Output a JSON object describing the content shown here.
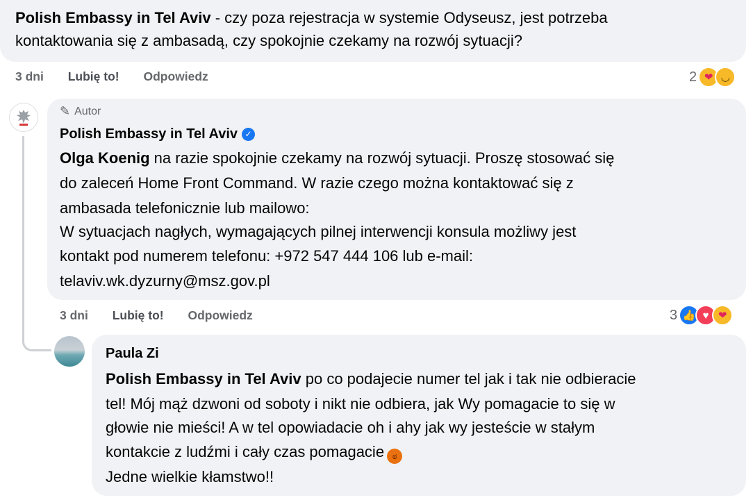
{
  "comment1": {
    "author": "Polish Embassy in Tel Aviv",
    "line1_rest": " - czy poza rejestracja w systemie Odyseusz, jest potrzeba",
    "line2": "kontaktowania się z ambasadą, czy spokojnie czekamy na rozwój sytuacji?",
    "time": "3 dni",
    "like": "Lubię to!",
    "reply": "Odpowiedz",
    "reaction_count": "2",
    "reactions": [
      "care-reaction",
      "haha-reaction"
    ]
  },
  "comment2": {
    "badge": "Autor",
    "author": "Polish Embassy in Tel Aviv",
    "mention": "Olga Koenig",
    "line1_rest": " na razie spokojnie czekamy na rozwój sytuacji. Proszę stosować się",
    "line2": "do zaleceń Home Front Command. W razie czego można kontaktować się z",
    "line3": "ambasada telefonicznie lub mailowo:",
    "line4": "W sytuacjach nagłych, wymagających pilnej interwencji konsula możliwy jest",
    "line5": "kontakt pod numerem telefonu: +972 547 444 106 lub e-mail:",
    "line6": "telaviv.wk.dyzurny@msz.gov.pl",
    "time": "3 dni",
    "like": "Lubię to!",
    "reply": "Odpowiedz",
    "reaction_count": "3",
    "reactions": [
      "like-reaction",
      "love-reaction",
      "care-reaction"
    ]
  },
  "comment3": {
    "author": "Paula Zi",
    "mention": "Polish Embassy in Tel Aviv",
    "line1_rest": " po co podajecie numer tel jak i tak nie odbieracie",
    "line2": "tel! Mój mąż dzwoni od soboty i nikt nie odbiera, jak Wy pomagacie to się w",
    "line3": "głowie nie mieści! A w tel opowiadacie oh i ahy jak wy jesteście w stałym",
    "line4": "kontakcie z ludźmi i cały czas pomagacie",
    "line5": "Jedne wielkie kłamstwo!!"
  },
  "colors": {
    "bubble": "#f0f2f5",
    "meta": "#65676b",
    "accent": "#1877f2"
  }
}
